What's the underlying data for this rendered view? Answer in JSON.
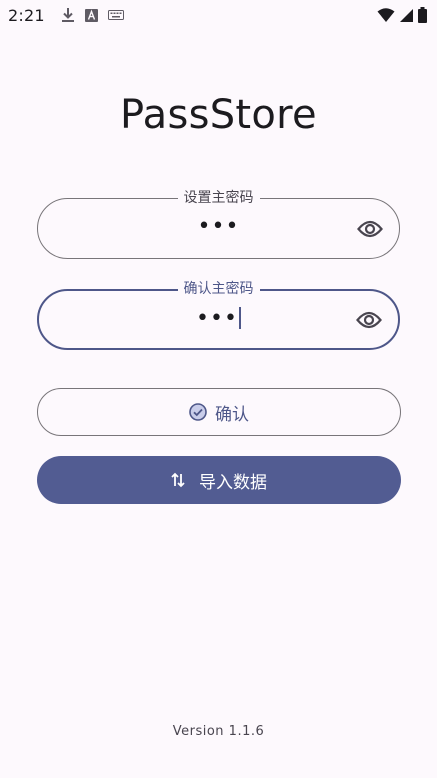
{
  "status_bar": {
    "time": "2:21",
    "icons": [
      "download-icon",
      "text-a-icon",
      "keyboard-icon",
      "wifi-icon",
      "signal-icon",
      "battery-icon"
    ]
  },
  "app": {
    "title": "PassStore",
    "version": "Version 1.1.6"
  },
  "form": {
    "master_password": {
      "label": "设置主密码",
      "value": "•••"
    },
    "confirm_password": {
      "label": "确认主密码",
      "value": "•••"
    }
  },
  "buttons": {
    "confirm_label": "确认",
    "import_label": "导入数据"
  },
  "colors": {
    "background": "#fdf9fd",
    "primary": "#525c92",
    "focused_outline": "#4e5789",
    "outline": "#787579"
  }
}
